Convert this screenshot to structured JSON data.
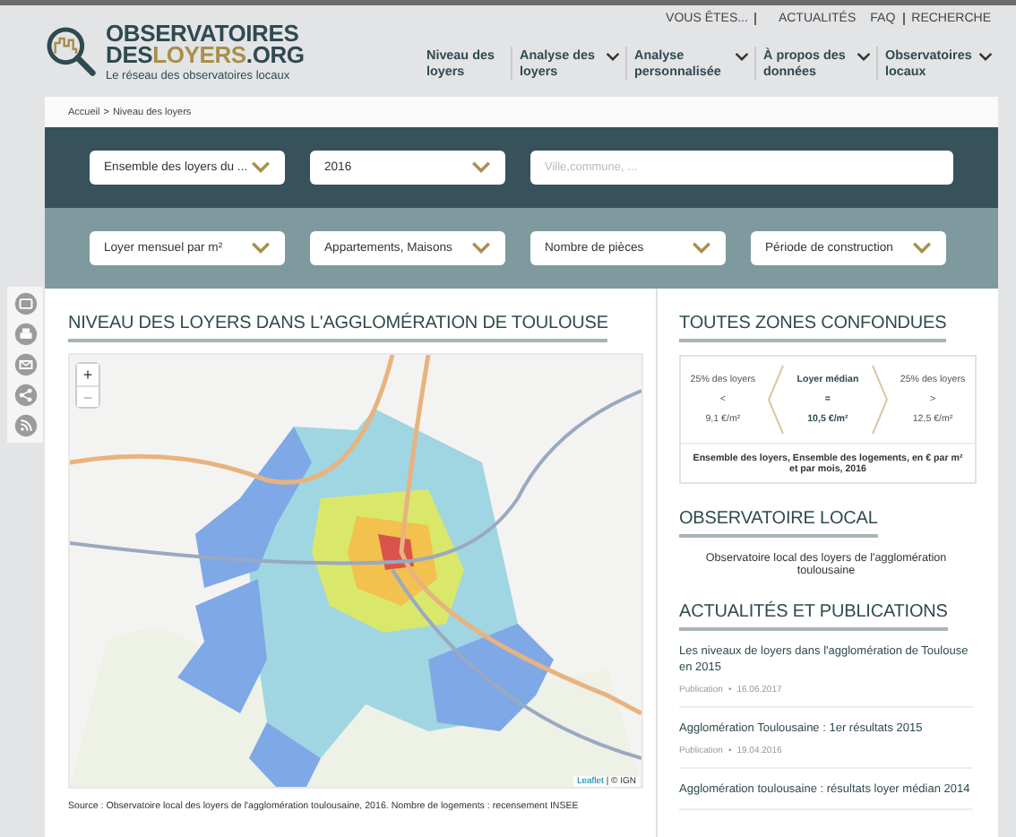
{
  "top_links": [
    {
      "label": "VOUS ÊTES...",
      "divider_after": true
    },
    {
      "label": "ACTUALITÉS",
      "divider_after": false
    },
    {
      "label": "FAQ",
      "divider_after": true
    },
    {
      "label": "RECHERCHE",
      "divider_after": false
    }
  ],
  "logo": {
    "line1": "OBSERVATOIRES",
    "line2": [
      "DES",
      "LOYERS",
      ".ORG"
    ],
    "tagline": "Le réseau des observatoires locaux"
  },
  "nav": [
    {
      "label": "Niveau des loyers",
      "dropdown": false
    },
    {
      "label": "Analyse des loyers",
      "dropdown": true
    },
    {
      "label": "Analyse personnalisée",
      "dropdown": true
    },
    {
      "label": "À propos des données",
      "dropdown": true
    },
    {
      "label": "Observatoires locaux",
      "dropdown": true
    }
  ],
  "breadcrumb": {
    "items": [
      "Accueil",
      "Niveau des loyers"
    ],
    "separator": ">"
  },
  "filters_primary": [
    {
      "kind": "select",
      "value": "Ensemble des loyers du ..."
    },
    {
      "kind": "select",
      "value": "2016"
    },
    {
      "kind": "input",
      "placeholder": "Ville,commune, ..."
    }
  ],
  "filters_secondary": [
    {
      "kind": "select",
      "value": "Loyer mensuel par m²"
    },
    {
      "kind": "select",
      "value": "Appartements, Maisons"
    },
    {
      "kind": "select",
      "value": "Nombre de pièces"
    },
    {
      "kind": "select",
      "value": "Période de construction"
    }
  ],
  "share_tools": [
    {
      "kind": "csv"
    },
    {
      "kind": "print"
    },
    {
      "kind": "mail"
    },
    {
      "kind": "share"
    },
    {
      "kind": "rss"
    }
  ],
  "map_section": {
    "title": "NIVEAU DES LOYERS DANS L'AGGLOMÉRATION DE TOULOUSE",
    "zoom_controls": [
      "+",
      "−"
    ],
    "attribution_link": "Leaflet",
    "attribution": "| © IGN",
    "source": "Source : Observatoire local des loyers de l'agglomération toulousaine, 2016. Nombre de logements : recensement INSEE"
  },
  "summary": {
    "title": "TOUTES ZONES CONFONDUES",
    "columns": [
      {
        "label": "25% des loyers",
        "sign": "<",
        "value": "9,1 €/m²",
        "emphasis": false
      },
      {
        "label": "Loyer médian",
        "sign": "=",
        "value": "10,5 €/m²",
        "emphasis": true
      },
      {
        "label": "25% des loyers",
        "sign": ">",
        "value": "12,5 €/m²",
        "emphasis": false
      }
    ],
    "note": "Ensemble des loyers, Ensemble des logements, en € par m² et par mois, 2016"
  },
  "local": {
    "title": "OBSERVATOIRE LOCAL",
    "text": "Observatoire local des loyers de l'agglomération toulousaine"
  },
  "news": {
    "title": "ACTUALITÉS ET PUBLICATIONS",
    "items": [
      {
        "title": "Les niveaux de loyers dans l'agglomération de Toulouse en 2015",
        "type": "Publication",
        "bullet": "•",
        "date": "16.06.2017"
      },
      {
        "title": "Agglomération Toulousaine : 1er résultats 2015",
        "type": "Publication",
        "bullet": "•",
        "date": "19.04.2016"
      },
      {
        "title": "Agglomération toulousaine : résultats loyer médian 2014"
      }
    ]
  }
}
